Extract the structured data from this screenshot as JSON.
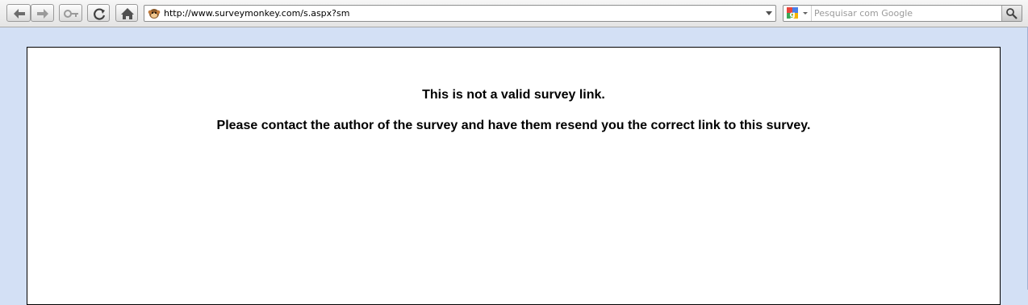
{
  "browser": {
    "url": "http://www.surveymonkey.com/s.aspx?sm",
    "search_placeholder": "Pesquisar com Google",
    "icons": {
      "back": "back-arrow-icon",
      "forward": "forward-arrow-icon",
      "key": "key-icon",
      "reload": "reload-icon",
      "home": "home-icon",
      "favicon": "surveymonkey-favicon",
      "search_engine": "google-icon",
      "search_go": "magnifier-icon"
    }
  },
  "page": {
    "line1": "This is not a valid survey link.",
    "line2": "Please contact the author of the survey and have them resend you the correct link to this survey."
  }
}
